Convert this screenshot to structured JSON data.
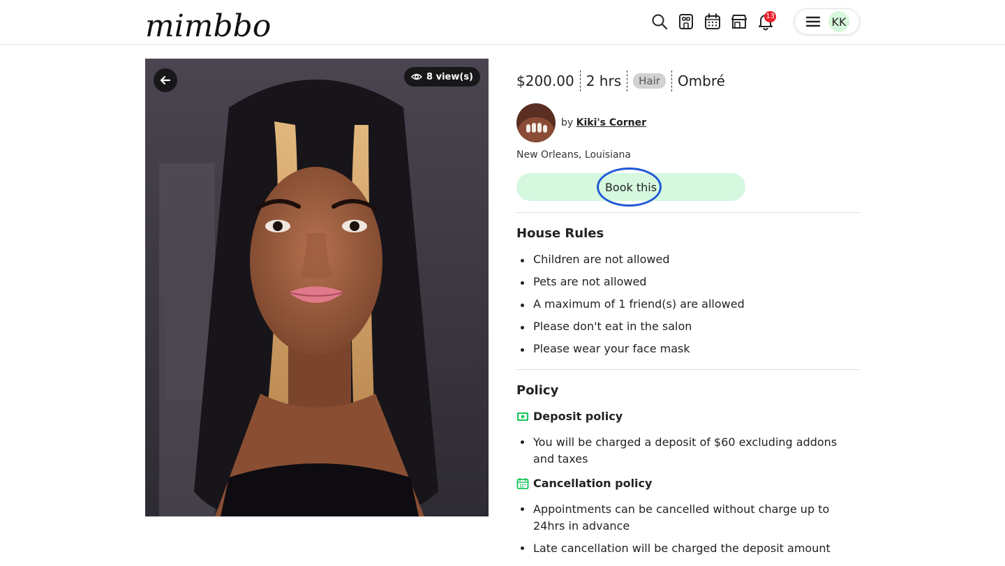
{
  "header": {
    "logo_text": "mimbbo",
    "icons": [
      "search-icon",
      "storefront-grid-icon",
      "calendar-icon",
      "shop-icon",
      "bell-icon",
      "hamburger-menu-icon"
    ],
    "notification_count": "13",
    "user_initials": "KK"
  },
  "photo": {
    "views_label": "8 view(s)"
  },
  "service": {
    "price": "$200.00",
    "duration": "2 hrs",
    "category": "Hair",
    "style": "Ombré"
  },
  "provider": {
    "by_prefix": "by",
    "name": "Kiki's Corner",
    "location": "New Orleans, Louisiana"
  },
  "book_button_label": "Book this",
  "house_rules": {
    "title": "House Rules",
    "items": [
      "Children are not allowed",
      "Pets are not allowed",
      "A maximum of 1 friend(s) are allowed",
      "Please don't eat in the salon",
      "Please wear your face mask"
    ]
  },
  "policy": {
    "title": "Policy",
    "deposit_title": "Deposit policy",
    "deposit_items": [
      "You will be charged a deposit of $60 excluding addons and taxes"
    ],
    "cancellation_title": "Cancellation policy",
    "cancellation_items": [
      "Appointments can be cancelled without charge up to 24hrs in advance",
      "Late cancellation will be charged the deposit amount"
    ]
  },
  "colors": {
    "accent_green": "#d5f8df",
    "icon_green": "#17c45a",
    "highlight_ring": "#1f59d6",
    "badge_red": "#e8202a"
  }
}
